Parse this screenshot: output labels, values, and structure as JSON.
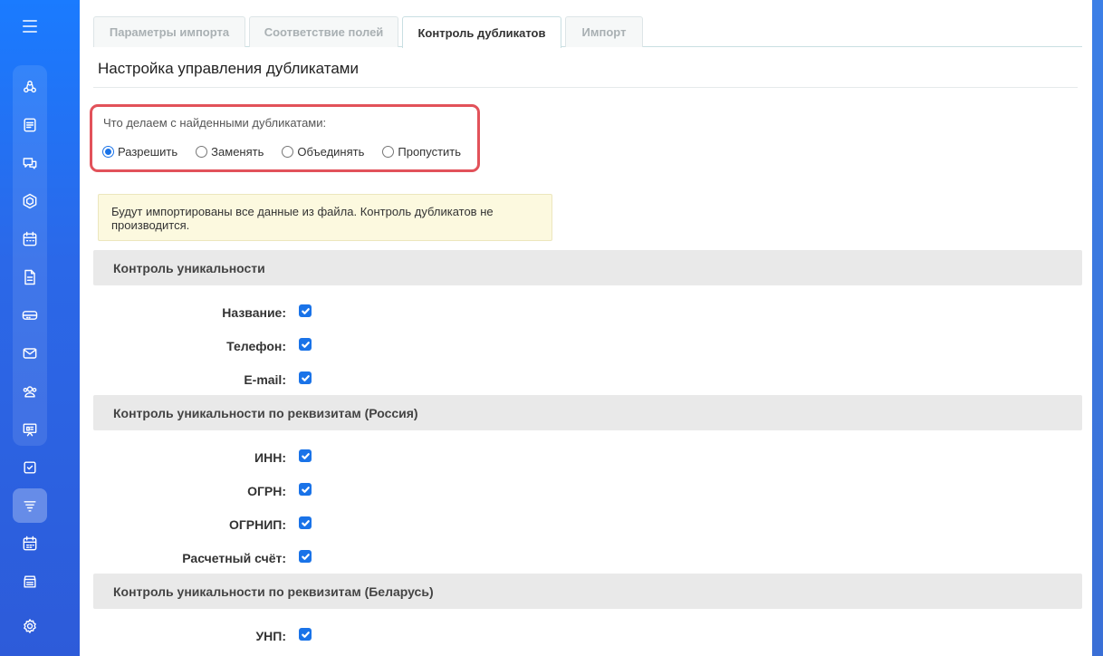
{
  "sidebar": {
    "icons": [
      "menu-icon",
      "deals-icon",
      "documents-icon",
      "chat-icon",
      "hexagon-icon",
      "calendar-icon",
      "file-icon",
      "card-icon",
      "mail-icon",
      "contacts-icon",
      "presentation-icon",
      "tasks-icon",
      "filter-icon",
      "schedule-icon",
      "store-icon",
      "settings-icon"
    ],
    "active": "filter-icon"
  },
  "tabs": [
    {
      "label": "Параметры импорта",
      "active": false
    },
    {
      "label": "Соответствие полей",
      "active": false
    },
    {
      "label": "Контроль дубликатов",
      "active": true
    },
    {
      "label": "Импорт",
      "active": false
    }
  ],
  "section_title": "Настройка управления дубликатами",
  "duplicates": {
    "question": "Что делаем с найденными дубликатами:",
    "options": [
      "Разрешить",
      "Заменять",
      "Объединять",
      "Пропустить"
    ],
    "selected": "Разрешить"
  },
  "notice": "Будут импортированы все данные из файла. Контроль дубликатов не производится.",
  "groups": [
    {
      "title": "Контроль уникальности",
      "fields": [
        {
          "label": "Название:",
          "checked": true
        },
        {
          "label": "Телефон:",
          "checked": true
        },
        {
          "label": "E-mail:",
          "checked": true
        }
      ]
    },
    {
      "title": "Контроль уникальности по реквизитам (Россия)",
      "fields": [
        {
          "label": "ИНН:",
          "checked": true
        },
        {
          "label": "ОГРН:",
          "checked": true
        },
        {
          "label": "ОГРНИП:",
          "checked": true
        },
        {
          "label": "Расчетный счёт:",
          "checked": true
        }
      ]
    },
    {
      "title": "Контроль уникальности по реквизитам (Беларусь)",
      "fields": [
        {
          "label": "УНП:",
          "checked": true
        }
      ]
    }
  ],
  "colors": {
    "sidebar": "#2b68e8",
    "accent": "#1a73e8",
    "highlight_border": "#e2525a",
    "notice_bg": "#fcf9df",
    "group_bg": "#e9e9e9"
  }
}
